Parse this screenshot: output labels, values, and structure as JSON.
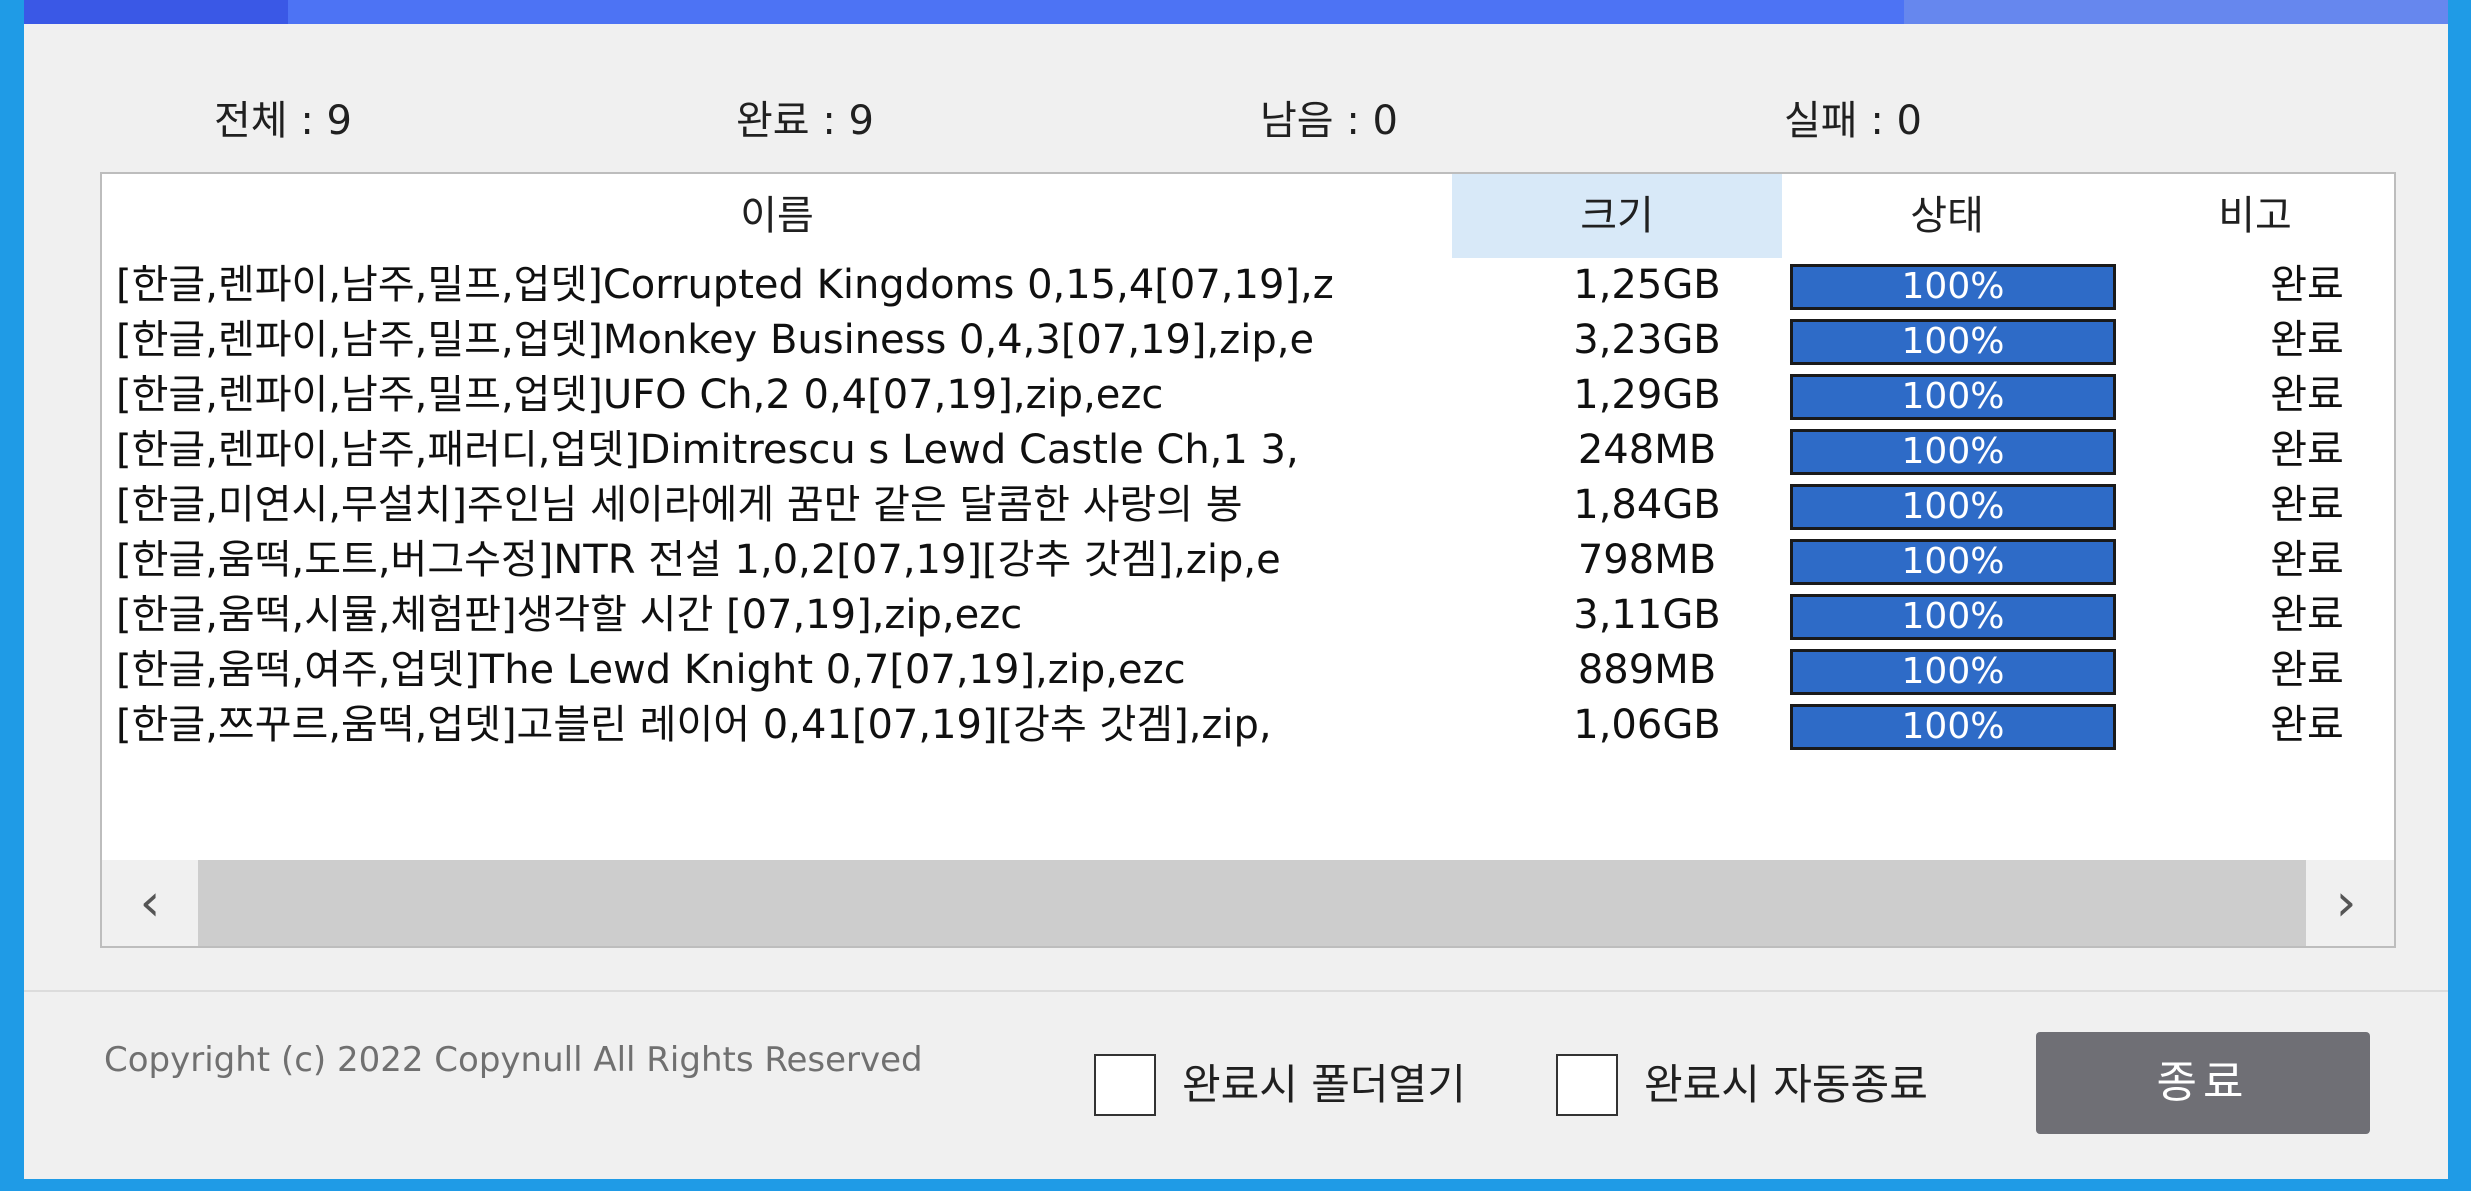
{
  "progress": {
    "fraction": 1.0,
    "colors": {
      "fill": "#3a58e6",
      "track": "#6687ee"
    }
  },
  "stats": {
    "total": "전체 : 9",
    "completed": "완료 : 9",
    "remaining": "남음 : 0",
    "failed": "실패 : 0"
  },
  "table": {
    "columns": [
      "이름",
      "크기",
      "상태",
      "비고"
    ],
    "rows": [
      {
        "name": "[한글,렌파이,남주,밀프,업뎃]Corrupted Kingdoms 0,15,4[07,19],z",
        "size": "1,25GB",
        "status": "100%",
        "note": "완료"
      },
      {
        "name": "[한글,렌파이,남주,밀프,업뎃]Monkey Business 0,4,3[07,19],zip,e",
        "size": "3,23GB",
        "status": "100%",
        "note": "완료"
      },
      {
        "name": "[한글,렌파이,남주,밀프,업뎃]UFO Ch,2 0,4[07,19],zip,ezc",
        "size": "1,29GB",
        "status": "100%",
        "note": "완료"
      },
      {
        "name": "[한글,렌파이,남주,패러디,업뎃]Dimitrescu s Lewd Castle Ch,1 3,",
        "size": "248MB",
        "status": "100%",
        "note": "완료"
      },
      {
        "name": "[한글,미연시,무설치]주인님 세이라에게 꿈만 같은 달콤한 사랑의 봉",
        "size": "1,84GB",
        "status": "100%",
        "note": "완료"
      },
      {
        "name": "[한글,움떡,도트,버그수정]NTR 전설 1,0,2[07,19][강추 갓겜],zip,e",
        "size": "798MB",
        "status": "100%",
        "note": "완료"
      },
      {
        "name": "[한글,움떡,시뮬,체험판]생각할 시간 [07,19],zip,ezc",
        "size": "3,11GB",
        "status": "100%",
        "note": "완료"
      },
      {
        "name": "[한글,움떡,여주,업뎃]The Lewd Knight  0,7[07,19],zip,ezc",
        "size": "889MB",
        "status": "100%",
        "note": "완료"
      },
      {
        "name": "[한글,쯔꾸르,움떡,업뎃]고블린 레이어 0,41[07,19][강추 갓겜],zip,",
        "size": "1,06GB",
        "status": "100%",
        "note": "완료"
      }
    ]
  },
  "scrollbar": {
    "left_icon": "‹",
    "right_icon": "›"
  },
  "footer": {
    "copyright": "Copyright (c) 2022 Copynull All Rights Reserved",
    "open_folder_label": "완료시 폴더열기",
    "auto_exit_label": "완료시 자동종료",
    "close_button": "종료"
  }
}
